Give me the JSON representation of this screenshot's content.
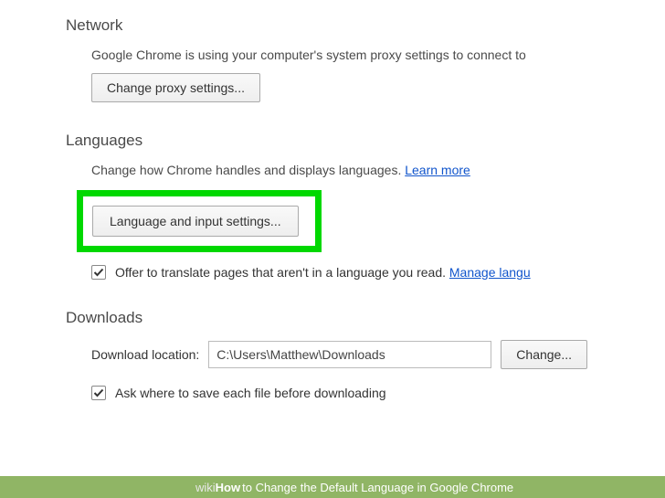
{
  "network": {
    "title": "Network",
    "desc": "Google Chrome is using your computer's system proxy settings to connect to",
    "button": "Change proxy settings..."
  },
  "languages": {
    "title": "Languages",
    "desc_pre": "Change how Chrome handles and displays languages. ",
    "learn_more": "Learn more",
    "button": "Language and input settings...",
    "translate_label": "Offer to translate pages that aren't in a language you read. ",
    "manage": "Manage langu"
  },
  "downloads": {
    "title": "Downloads",
    "location_label": "Download location:",
    "location_value": "C:\\Users\\Matthew\\Downloads",
    "change": "Change...",
    "ask_label": "Ask where to save each file before downloading"
  },
  "footer": {
    "wiki": "wiki",
    "how": "How",
    "rest": " to Change the Default Language in Google Chrome"
  }
}
